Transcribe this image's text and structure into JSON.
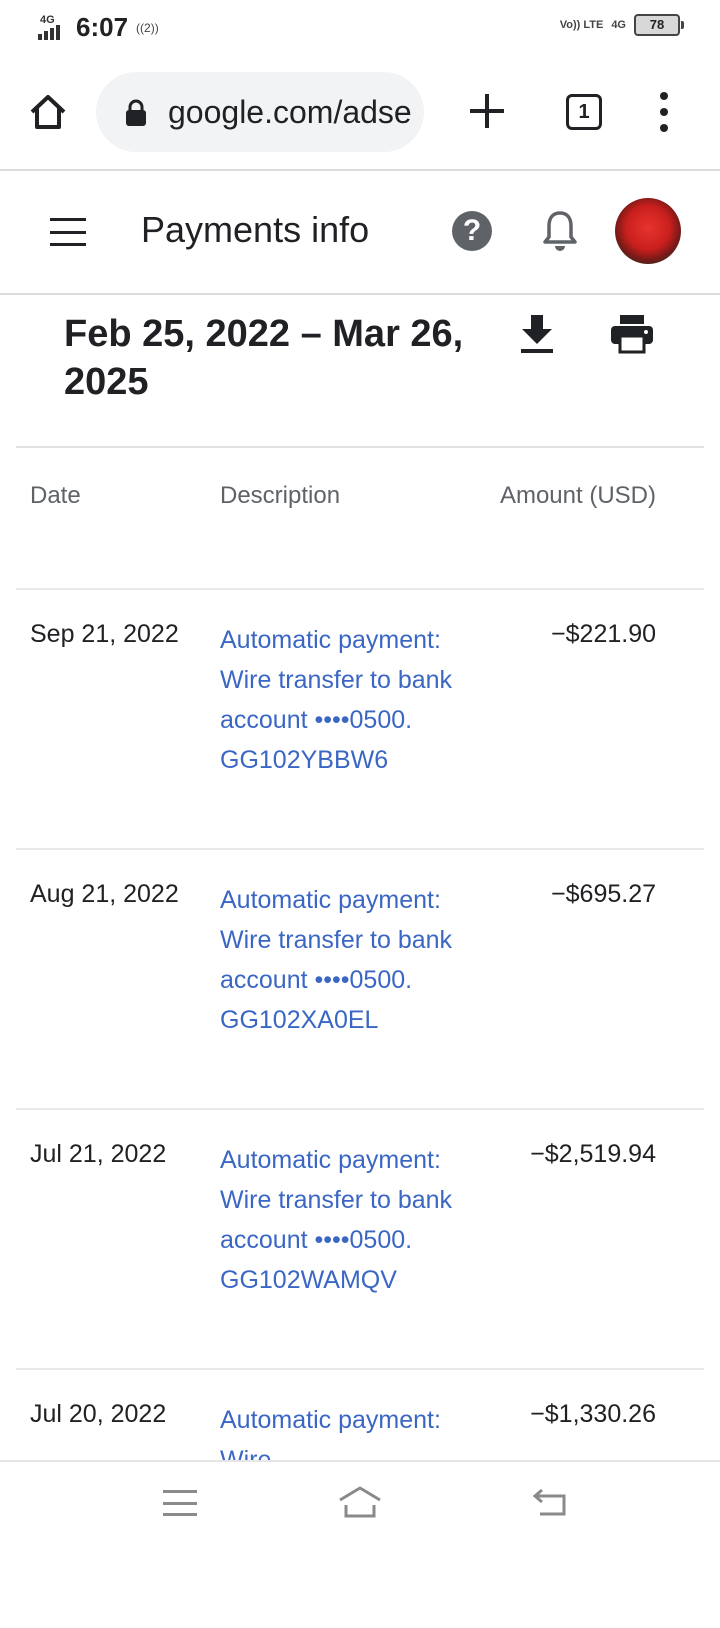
{
  "status_bar": {
    "network": "4G",
    "time": "6:07",
    "hotspot": "((2))",
    "volte": "Vo)) LTE",
    "data_network": "4G",
    "battery": "78"
  },
  "browser": {
    "url": "google.com/adse",
    "tab_count": "1",
    "icons": [
      "home-icon",
      "lock-icon",
      "plus-icon",
      "tabs-icon",
      "more-vert-icon"
    ]
  },
  "header": {
    "title": "Payments info",
    "icons": [
      "menu-icon",
      "help-icon",
      "bell-icon",
      "avatar"
    ]
  },
  "range": {
    "label": "Feb 25, 2022 – Mar 26, 2025",
    "icons": [
      "download-icon",
      "print-icon"
    ]
  },
  "table": {
    "headers": {
      "date": "Date",
      "description": "Description",
      "amount": "Amount (USD)"
    },
    "rows": [
      {
        "date": "Sep 21, 2022",
        "description": "Automatic payment: Wire transfer to bank account ••••0500. GG102YBBW6",
        "amount": "−$221.90"
      },
      {
        "date": "Aug 21, 2022",
        "description": "Automatic payment: Wire transfer to bank account ••••0500. GG102XA0EL",
        "amount": "−$695.27"
      },
      {
        "date": "Jul 21, 2022",
        "description": "Automatic payment: Wire transfer to bank account ••••0500. GG102WAMQV",
        "amount": "−$2,519.94"
      },
      {
        "date": "Jul 20, 2022",
        "description": "Automatic payment: Wire",
        "amount": "−$1,330.26"
      }
    ]
  },
  "nav": {
    "icons": [
      "recents-icon",
      "home-icon",
      "back-icon"
    ]
  }
}
